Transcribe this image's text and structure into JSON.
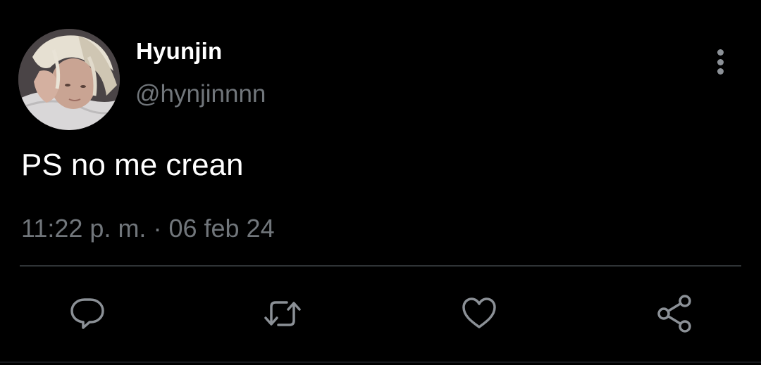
{
  "tweet": {
    "author": {
      "display_name": "Hyunjin",
      "handle": "@hynjinnnn",
      "avatar": "profile-photo"
    },
    "text": "PS no me crean",
    "time": "11:22 p. m.",
    "separator": "·",
    "date": "06 feb 24"
  },
  "actions": {
    "reply_icon": "reply-icon",
    "retweet_icon": "retweet-icon",
    "like_icon": "heart-icon",
    "share_icon": "share-icon",
    "more_icon": "more-vertical-icon"
  },
  "colors": {
    "background": "#000000",
    "primary_text": "#ffffff",
    "secondary_text": "#71767b",
    "divider": "#2f3336",
    "icon": "#8b9096"
  }
}
